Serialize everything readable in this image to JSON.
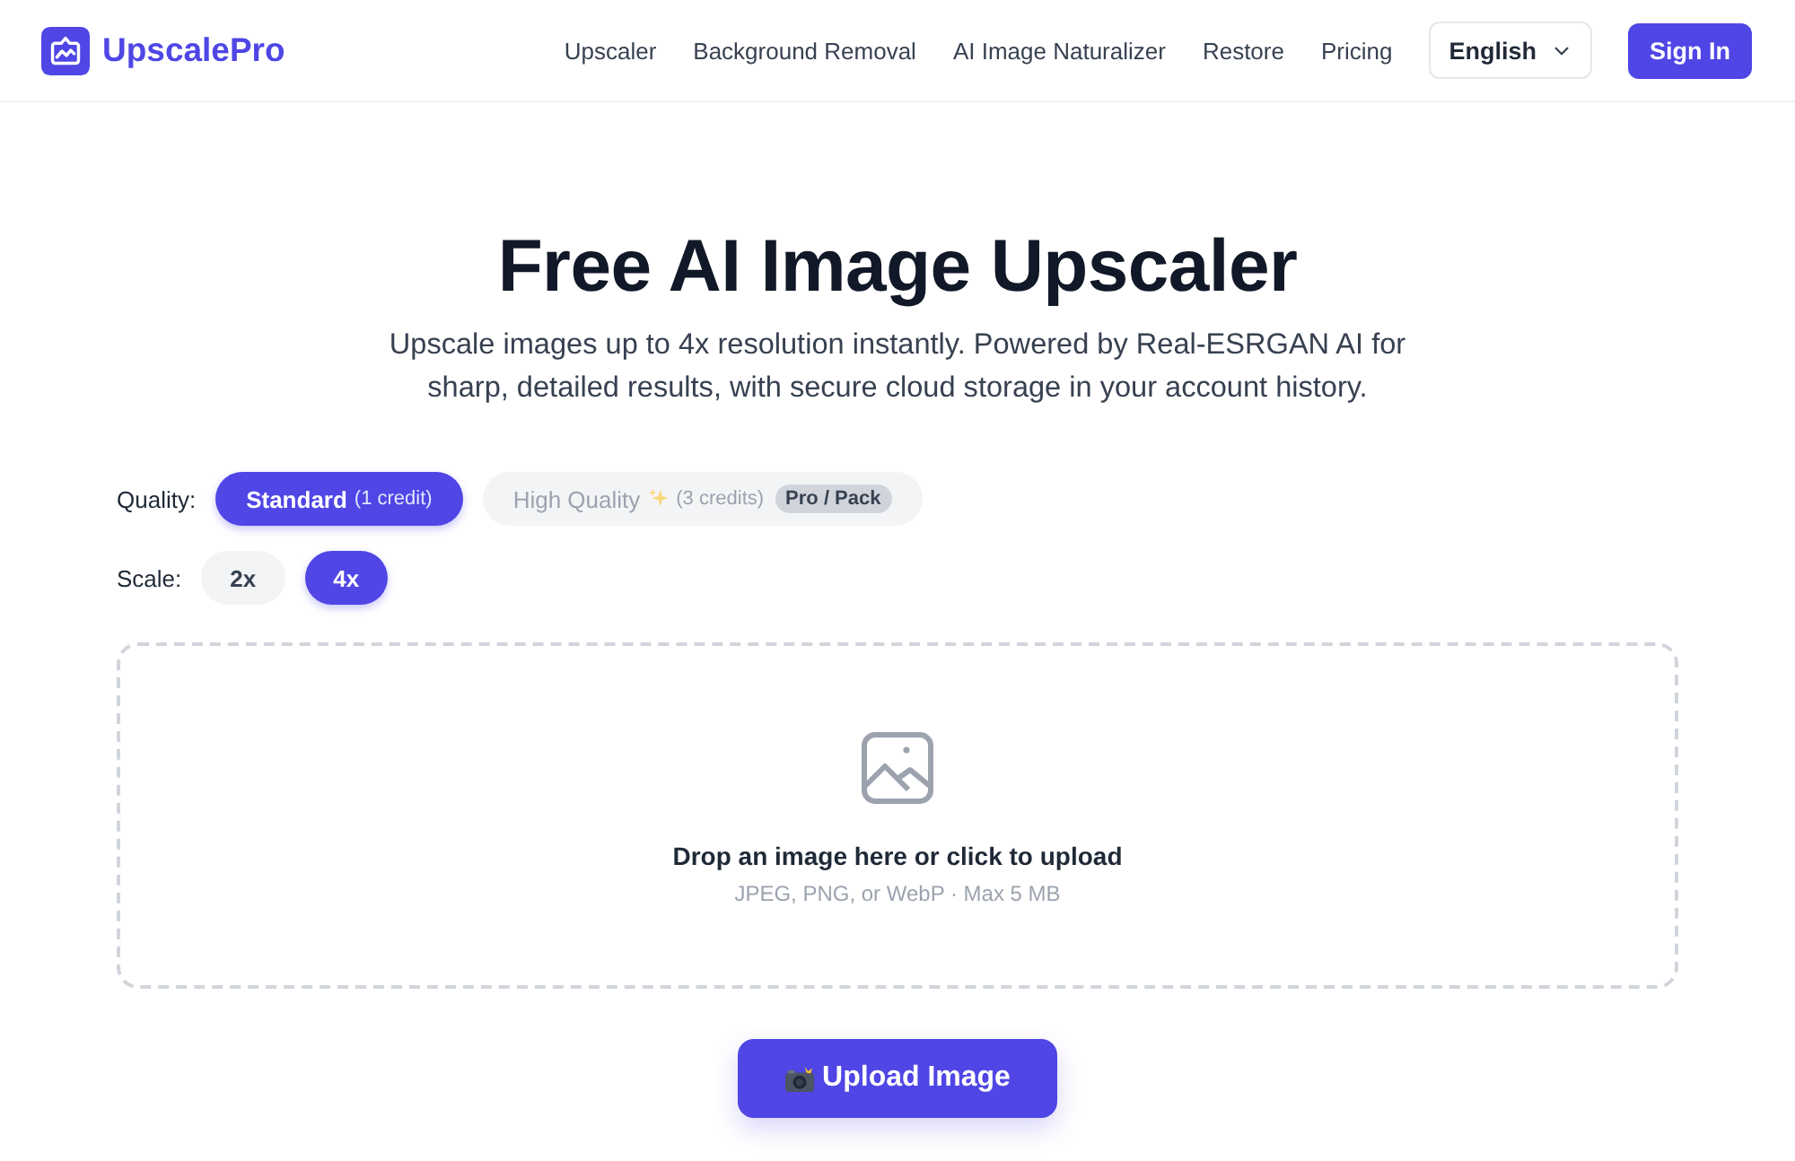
{
  "header": {
    "brand": "UpscalePro",
    "nav": [
      {
        "label": "Upscaler"
      },
      {
        "label": "Background Removal"
      },
      {
        "label": "AI Image Naturalizer"
      },
      {
        "label": "Restore"
      },
      {
        "label": "Pricing"
      }
    ],
    "language": {
      "value": "English"
    },
    "sign_in": "Sign In"
  },
  "hero": {
    "title": "Free AI Image Upscaler",
    "subtitle": "Upscale images up to 4x resolution instantly. Powered by Real-ESRGAN AI for sharp, detailed results, with secure cloud storage in your account history."
  },
  "quality": {
    "label": "Quality:",
    "options": [
      {
        "kind": "standard",
        "label": "Standard",
        "note": "(1 credit)",
        "selected": true,
        "disabled": false
      },
      {
        "kind": "premium",
        "label": "High Quality",
        "note": "(3 credits)",
        "badge": "Pro / Pack",
        "selected": false,
        "disabled": true
      }
    ]
  },
  "scale": {
    "label": "Scale:",
    "options": [
      {
        "label": "2x",
        "selected": false
      },
      {
        "label": "4x",
        "selected": true
      }
    ]
  },
  "dropzone": {
    "title": "Drop an image here or click to upload",
    "hint": "JPEG, PNG, or WebP · Max 5 MB"
  },
  "upload_button": {
    "label": "Upload Image"
  }
}
